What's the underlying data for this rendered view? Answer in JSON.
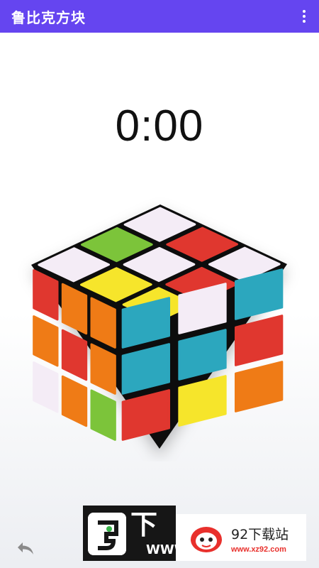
{
  "app": {
    "title": "鲁比克方块"
  },
  "timer": {
    "value": "0:00"
  },
  "colors": {
    "app_bar": "#6545f0",
    "white": "#f4ecf6",
    "red": "#e0372f",
    "yellow": "#f6e52b",
    "green": "#7cc43a",
    "orange": "#ef7b16",
    "blue": "#2ca7be"
  },
  "cube": {
    "top_face": [
      [
        "white",
        "red",
        "white"
      ],
      [
        "green",
        "white",
        "red"
      ],
      [
        "white",
        "yellow",
        "yellow"
      ]
    ],
    "left_face": [
      [
        "red",
        "orange",
        "orange"
      ],
      [
        "orange",
        "red",
        "orange"
      ],
      [
        "white",
        "orange",
        "green"
      ]
    ],
    "right_face": [
      [
        "blue",
        "white",
        "blue"
      ],
      [
        "blue",
        "blue",
        "red"
      ],
      [
        "red",
        "yellow",
        "orange"
      ]
    ]
  },
  "icons": {
    "menu": "more-vert-icon",
    "undo": "undo-icon"
  },
  "watermark": {
    "glyph": "下",
    "www": "WWW",
    "brand": "92下载站",
    "url": "www.xz92.com"
  }
}
